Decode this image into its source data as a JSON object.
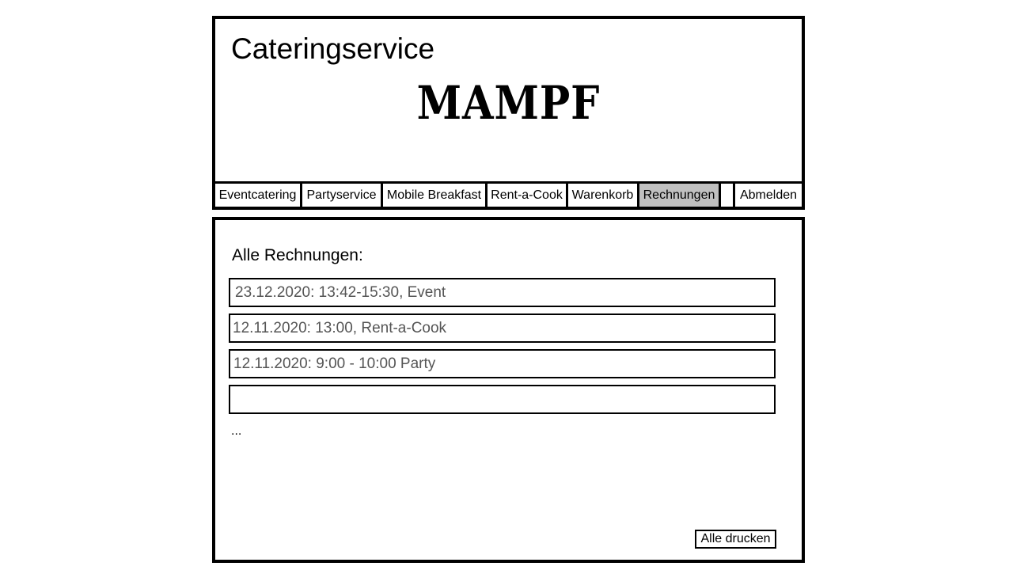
{
  "header": {
    "title": "Cateringservice",
    "logo_text": "MAMPF"
  },
  "nav": {
    "items": [
      {
        "label": "Eventcatering"
      },
      {
        "label": "Partyservice"
      },
      {
        "label": "Mobile Breakfast"
      },
      {
        "label": "Rent-a-Cook"
      },
      {
        "label": "Warenkorb"
      },
      {
        "label": "Rechnungen",
        "active": true
      },
      {
        "label": ""
      },
      {
        "label": "Abmelden"
      }
    ]
  },
  "main": {
    "heading": "Alle Rechnungen:",
    "invoices": [
      {
        "text": "23.12.2020: 13:42-15:30, Event"
      },
      {
        "text": "12.11.2020: 13:00, Rent-a-Cook"
      },
      {
        "text": "12.11.2020: 9:00 - 10:00 Party"
      },
      {
        "text": ""
      }
    ],
    "more_indicator": "...",
    "print_all_label": "Alle drucken"
  },
  "colors": {
    "border": "#000000",
    "active_tab": "#c0c0c0",
    "invoice_text": "#555555"
  }
}
